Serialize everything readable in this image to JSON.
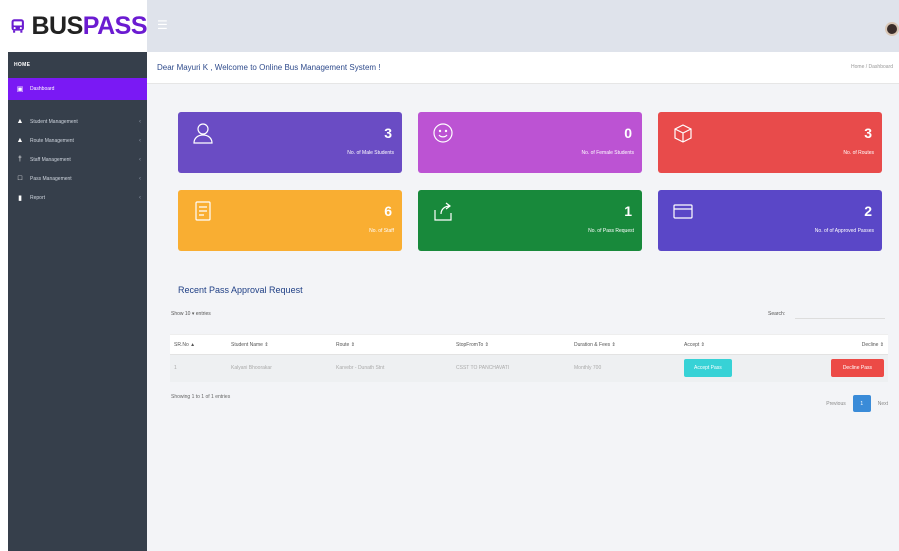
{
  "brand": {
    "name_a": "BUS",
    "name_b": "PASS",
    "accent": "#6b1bd1"
  },
  "topbar": {
    "toggle_icon": "menu-icon"
  },
  "sidebar": {
    "header": "HOME",
    "items": [
      {
        "label": "Dashboard",
        "icon": "calendar-icon",
        "active": true
      },
      {
        "label": "Student Management",
        "icon": "graduation-icon"
      },
      {
        "label": "Route Management",
        "icon": "road-icon"
      },
      {
        "label": "Staff Management",
        "icon": "person-icon"
      },
      {
        "label": "Pass Management",
        "icon": "square-icon"
      },
      {
        "label": "Report",
        "icon": "file-icon"
      }
    ]
  },
  "header": {
    "welcome": "Dear Mayuri K , Welcome to Online Bus Management System !",
    "breadcrumb": "Home / Dashboard"
  },
  "cards": [
    {
      "value": "3",
      "label": "No. of Male Students",
      "color": "#6a4cc4",
      "icon": "user-icon"
    },
    {
      "value": "0",
      "label": "No. of Female Students",
      "color": "#bc53d3",
      "icon": "smile-icon"
    },
    {
      "value": "3",
      "label": "No. of Routes",
      "color": "#e84b4b",
      "icon": "box-icon"
    },
    {
      "value": "6",
      "label": "No. of Staff",
      "color": "#f9ae32",
      "icon": "document-icon"
    },
    {
      "value": "1",
      "label": "No. of Pass Request",
      "color": "#18893b",
      "icon": "share-icon"
    },
    {
      "value": "2",
      "label": "No. of of Approved Passes",
      "color": "#5a47c7",
      "icon": "card-icon"
    }
  ],
  "recent": {
    "title": "Recent Pass Approval Request",
    "show_prefix": "Show",
    "show_value": "10",
    "show_suffix": "entries",
    "search_label": "Search:",
    "columns": [
      "SR.No",
      "Student Name",
      "Route",
      "StopFromTo",
      "Duration & Fees",
      "Accept",
      "Decline"
    ],
    "rows": [
      {
        "sr": "1",
        "student": "Kalyani Bhoorakar",
        "route": "Karvebr - Dunath Stnt",
        "stop": "CSST TO PANCHAVATI",
        "duration": "Monthly 700",
        "accept": "Accept Pass",
        "decline": "Decline Pass"
      }
    ],
    "info": "Showing 1 to 1 of 1 entries",
    "pager": {
      "prev": "Previous",
      "page": "1",
      "next": "Next"
    }
  }
}
